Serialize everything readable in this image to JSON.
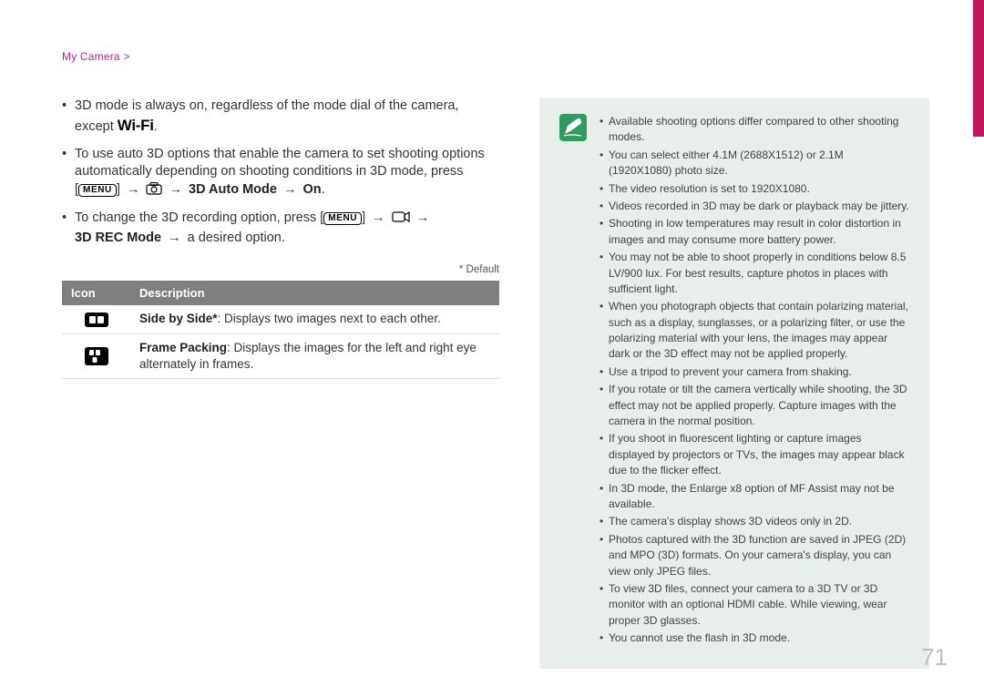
{
  "breadcrumb": "My Camera >",
  "page_number": "71",
  "left": {
    "b1_before_wifi": "3D mode is always on, regardless of the mode dial of the camera, except ",
    "wifi_label": "Wi-Fi",
    "b1_after_wifi": ".",
    "b2_line1": "To use auto 3D options that enable the camera to set shooting options automatically depending on shooting conditions in 3D mode, press ",
    "b2_lb": "[",
    "b2_menu": "MENU",
    "b2_rb": "]",
    "arrow": " → ",
    "b2_strong": "3D Auto Mode",
    "b2_on": "On",
    "b2_period": ".",
    "b3_pre": "To change the 3D recording option, press [",
    "b3_menu": "MENU",
    "b3_rb": "]",
    "b3_strong": "3D REC Mode",
    "b3_tail": " a desired option.",
    "default_label": "* Default",
    "th_icon": "Icon",
    "th_desc": "Description",
    "row1_name": "Side by Side*",
    "row1_rest": ": Displays two images next to each other.",
    "row2_name": "Frame Packing",
    "row2_rest": ": Displays the images for the left and right eye alternately in frames."
  },
  "notes": [
    "Available shooting options differ compared to other shooting modes.",
    "You can select either 4.1M (2688X1512) or 2.1M (1920X1080) photo size.",
    "The video resolution is set to 1920X1080.",
    "Videos recorded in 3D may be dark or playback may be jittery.",
    "Shooting in low temperatures may result in color distortion in images and may consume more battery power.",
    "You may not be able to shoot properly in conditions below 8.5 LV/900 lux. For best results, capture photos in places with sufficient light.",
    "When you photograph objects that contain polarizing material, such as a display, sunglasses, or a polarizing filter, or use the polarizing material with your lens, the images may appear dark or the 3D effect may not be applied properly.",
    "Use a tripod to prevent your camera from shaking.",
    "If you rotate or tilt the camera vertically while shooting, the 3D effect may not be applied properly. Capture images with the camera in the normal position.",
    "If you shoot in fluorescent lighting or capture images displayed by projectors or TVs, the images may appear black due to the flicker effect.",
    "In 3D mode, the Enlarge x8 option of MF Assist may not be available.",
    "The camera's display shows 3D videos only in 2D.",
    "Photos captured with the 3D function are saved in JPEG (2D) and MPO (3D) formats. On your camera's display, you can view only JPEG files.",
    "To view 3D files, connect your camera to a 3D TV or 3D monitor with an optional HDMI cable. While viewing, wear proper 3D glasses.",
    "You cannot use the flash in 3D mode."
  ]
}
